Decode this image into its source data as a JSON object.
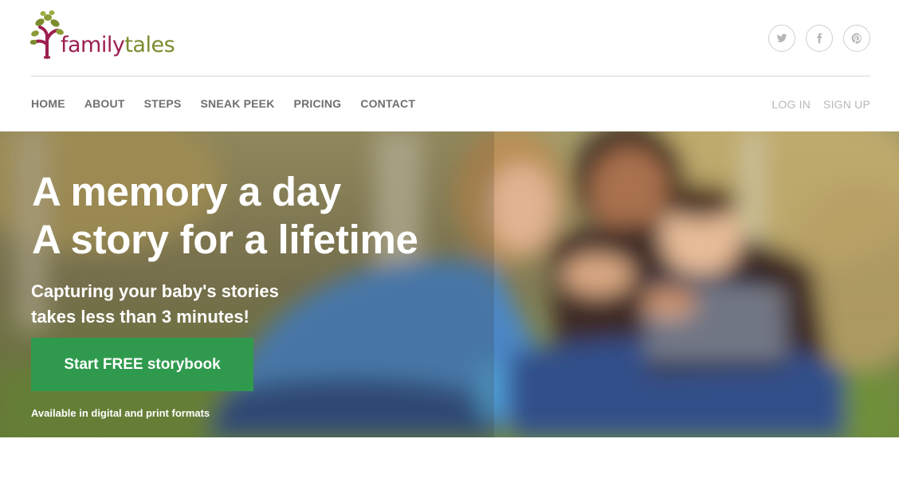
{
  "brand": {
    "name_part1": "family",
    "name_part2": "tales",
    "colors": {
      "primary": "#9c1f4f",
      "secondary": "#7a8c2e",
      "cta": "#2f9a4d"
    }
  },
  "social": [
    {
      "name": "twitter",
      "icon": "twitter-icon"
    },
    {
      "name": "facebook",
      "icon": "facebook-icon"
    },
    {
      "name": "pinterest",
      "icon": "pinterest-icon"
    }
  ],
  "nav": {
    "items": [
      {
        "label": "HOME"
      },
      {
        "label": "ABOUT"
      },
      {
        "label": "STEPS"
      },
      {
        "label": "SNEAK PEEK"
      },
      {
        "label": "PRICING"
      },
      {
        "label": "CONTACT"
      }
    ],
    "login": "LOG IN",
    "signup": "SIGN UP"
  },
  "hero": {
    "title_line1": "A memory a day",
    "title_line2": "A story for a lifetime",
    "subtitle_line1": "Capturing your baby's stories",
    "subtitle_line2": "takes less than 3 minutes!",
    "cta_label": "Start FREE storybook",
    "note": "Available in digital and print formats"
  }
}
